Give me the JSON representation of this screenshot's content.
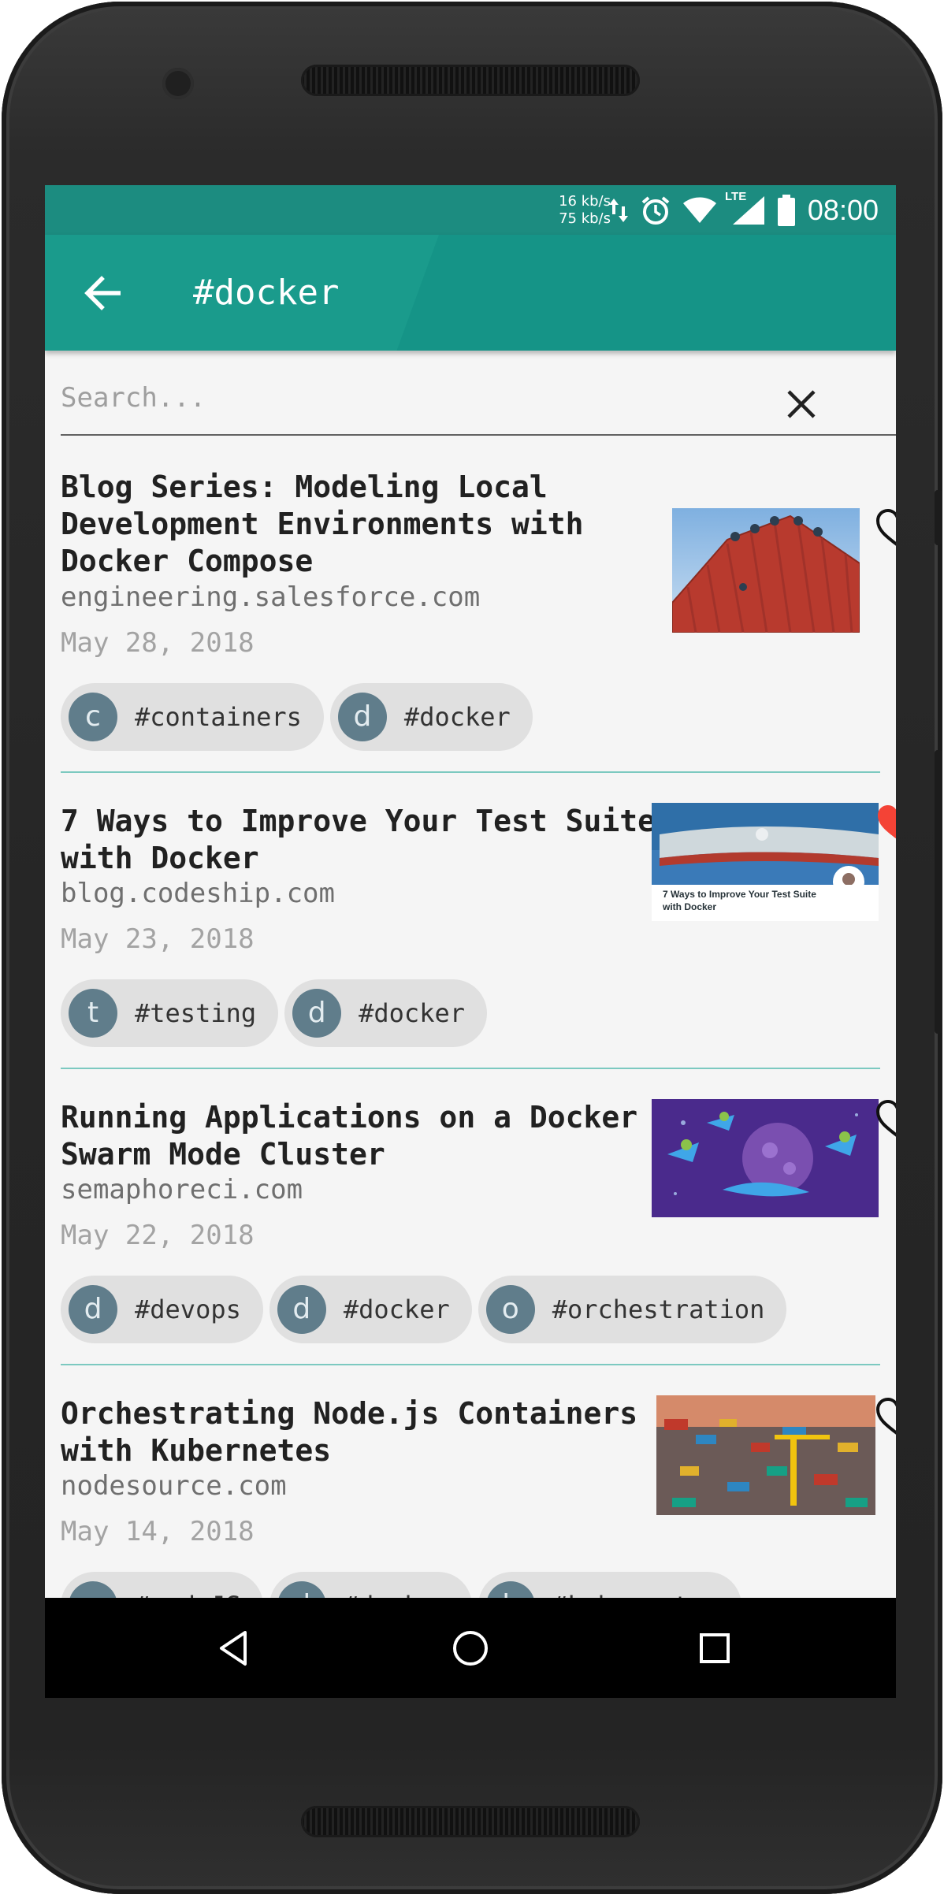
{
  "status_bar": {
    "net_down": "16 kb/s",
    "net_up": "75 kb/s",
    "network_type": "LTE",
    "time": "08:00",
    "icons": [
      "data-transfer-icon",
      "alarm-icon",
      "wifi-icon",
      "signal-icon",
      "battery-icon"
    ]
  },
  "toolbar": {
    "title": "#docker",
    "back_icon": "arrow-left-icon"
  },
  "search": {
    "placeholder": "Search...",
    "value": "",
    "clear_icon": "close-icon"
  },
  "articles": [
    {
      "title": "Blog Series: Modeling Local Development Environments with Docker Compose",
      "domain": "engineering.salesforce.com",
      "date": "May 28, 2018",
      "favorited": false,
      "tags": [
        {
          "initial": "c",
          "label": "#containers"
        },
        {
          "initial": "d",
          "label": "#docker"
        }
      ]
    },
    {
      "title": "7 Ways to Improve Your Test Suite with Docker",
      "domain": "blog.codeship.com",
      "date": "May 23, 2018",
      "favorited": true,
      "thumb_text": "7 Ways to Improve Your Test Suite with Docker",
      "tags": [
        {
          "initial": "t",
          "label": "#testing"
        },
        {
          "initial": "d",
          "label": "#docker"
        }
      ]
    },
    {
      "title": "Running Applications on a Docker Swarm Mode Cluster",
      "domain": "semaphoreci.com",
      "date": "May 22, 2018",
      "favorited": false,
      "tags": [
        {
          "initial": "d",
          "label": "#devops"
        },
        {
          "initial": "d",
          "label": "#docker"
        },
        {
          "initial": "o",
          "label": "#orchestration"
        }
      ]
    },
    {
      "title": "Orchestrating Node.js Containers with Kubernetes",
      "domain": "nodesource.com",
      "date": "May 14, 2018",
      "favorited": false,
      "tags": [
        {
          "initial": "n",
          "label": "#nodeJS"
        },
        {
          "initial": "d",
          "label": "#docker"
        },
        {
          "initial": "k",
          "label": "#kubernetes"
        }
      ]
    }
  ],
  "nav_bar": {
    "icons": [
      "back-triangle-icon",
      "home-circle-icon",
      "recents-square-icon"
    ]
  },
  "colors": {
    "status_bar": "#1c8c80",
    "toolbar": "#1a9b8c",
    "chip_avatar": "#607d8b",
    "divider": "#7cc9c0",
    "heart_active": "#f44336"
  }
}
